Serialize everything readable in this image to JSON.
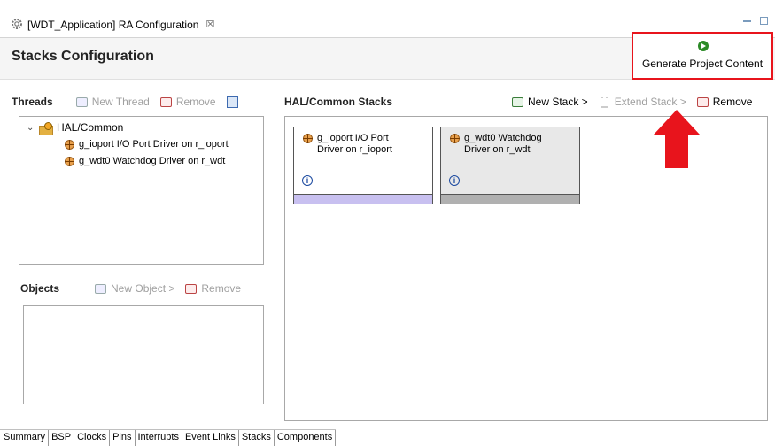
{
  "editor": {
    "tab_title": "[WDT_Application] RA Configuration",
    "tab_close": "☒"
  },
  "header": {
    "title": "Stacks Configuration",
    "generate_button": "Generate Project Content"
  },
  "threads": {
    "title": "Threads",
    "new_thread": "New Thread",
    "remove": "Remove",
    "tree": {
      "root": "HAL/Common",
      "items": [
        "g_ioport I/O Port Driver on r_ioport",
        "g_wdt0 Watchdog Driver on r_wdt"
      ]
    }
  },
  "objects": {
    "title": "Objects",
    "new_object": "New Object >",
    "remove": "Remove"
  },
  "stacks": {
    "title": "HAL/Common Stacks",
    "new_stack": "New Stack >",
    "extend_stack": "Extend Stack >",
    "remove": "Remove",
    "cards": [
      {
        "line1": "g_ioport I/O Port",
        "line2": "Driver on r_ioport",
        "bar_color": "#c8c0f0",
        "bg": "#ffffff"
      },
      {
        "line1": "g_wdt0 Watchdog",
        "line2": "Driver on r_wdt",
        "bar_color": "#b0b0b0",
        "bg": "#e8e8e8"
      }
    ],
    "info_glyph": "i"
  },
  "bottom_tabs": [
    "Summary",
    "BSP",
    "Clocks",
    "Pins",
    "Interrupts",
    "Event Links",
    "Stacks",
    "Components"
  ],
  "active_tab": "Stacks",
  "colors": {
    "highlight_red": "#e8141c",
    "generate_icon_green": "#2c8a27"
  },
  "icons": {
    "editor_tab": "gear-icon",
    "generate": "play-icon",
    "root": "folder-icon",
    "item": "module-icon",
    "info": "info-icon"
  }
}
